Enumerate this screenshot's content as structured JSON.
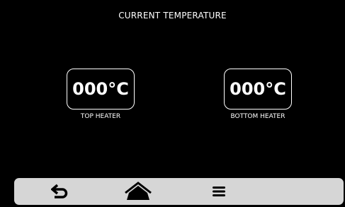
{
  "screen": {
    "title": "CURRENT TEMPERATURE"
  },
  "heaters": [
    {
      "value": "000°C",
      "label": "TOP HEATER"
    },
    {
      "value": "000°C",
      "label": "BOTTOM HEATER"
    }
  ],
  "navbar": {
    "buttons": [
      {
        "icon": "back-icon"
      },
      {
        "icon": "home-icon"
      },
      {
        "icon": "menu-icon"
      }
    ]
  },
  "colors": {
    "background": "#000000",
    "foreground": "#ffffff",
    "navbar": "#d6d6d6",
    "icon": "#000000"
  }
}
